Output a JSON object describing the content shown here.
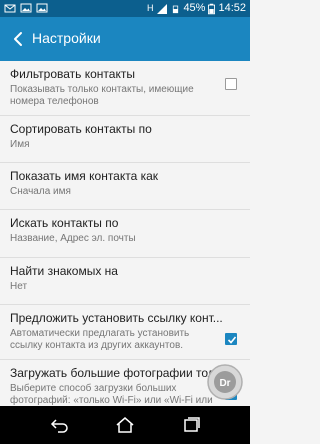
{
  "status_bar": {
    "battery": "45%",
    "time": "14:52",
    "network": "H"
  },
  "header": {
    "title": "Настройки"
  },
  "settings": [
    {
      "title": "Фильтровать контакты",
      "subtitle": "Показывать только контакты, имеющие номера телефонов",
      "checkbox": "unchecked"
    },
    {
      "title": "Сортировать контакты по",
      "subtitle": "Имя"
    },
    {
      "title": "Показать имя контакта как",
      "subtitle": "Сначала имя"
    },
    {
      "title": "Искать контакты по",
      "subtitle": "Название, Адрес эл. почты"
    },
    {
      "title": "Найти знакомых на",
      "subtitle": "Нет"
    },
    {
      "title": "Предложить установить ссылку конт...",
      "subtitle": "Автоматически предлагать установить ссылку контакта из других аккаунтов.",
      "checkbox": "checked"
    },
    {
      "title": "Загружать большие фотографии толь...",
      "subtitle": "Выберите способ загрузки больших фотографий: «только Wi-Fi» или «Wi-Fi или Мобильный интернет»",
      "checkbox": "checked"
    }
  ],
  "colors": {
    "status_bar": "#0c5f8e",
    "app_bar": "#1b86c0",
    "accent": "#1b86c0"
  },
  "icons": {
    "back": "arrow-left-icon",
    "nav": [
      "back-icon",
      "home-icon",
      "recents-icon"
    ]
  }
}
